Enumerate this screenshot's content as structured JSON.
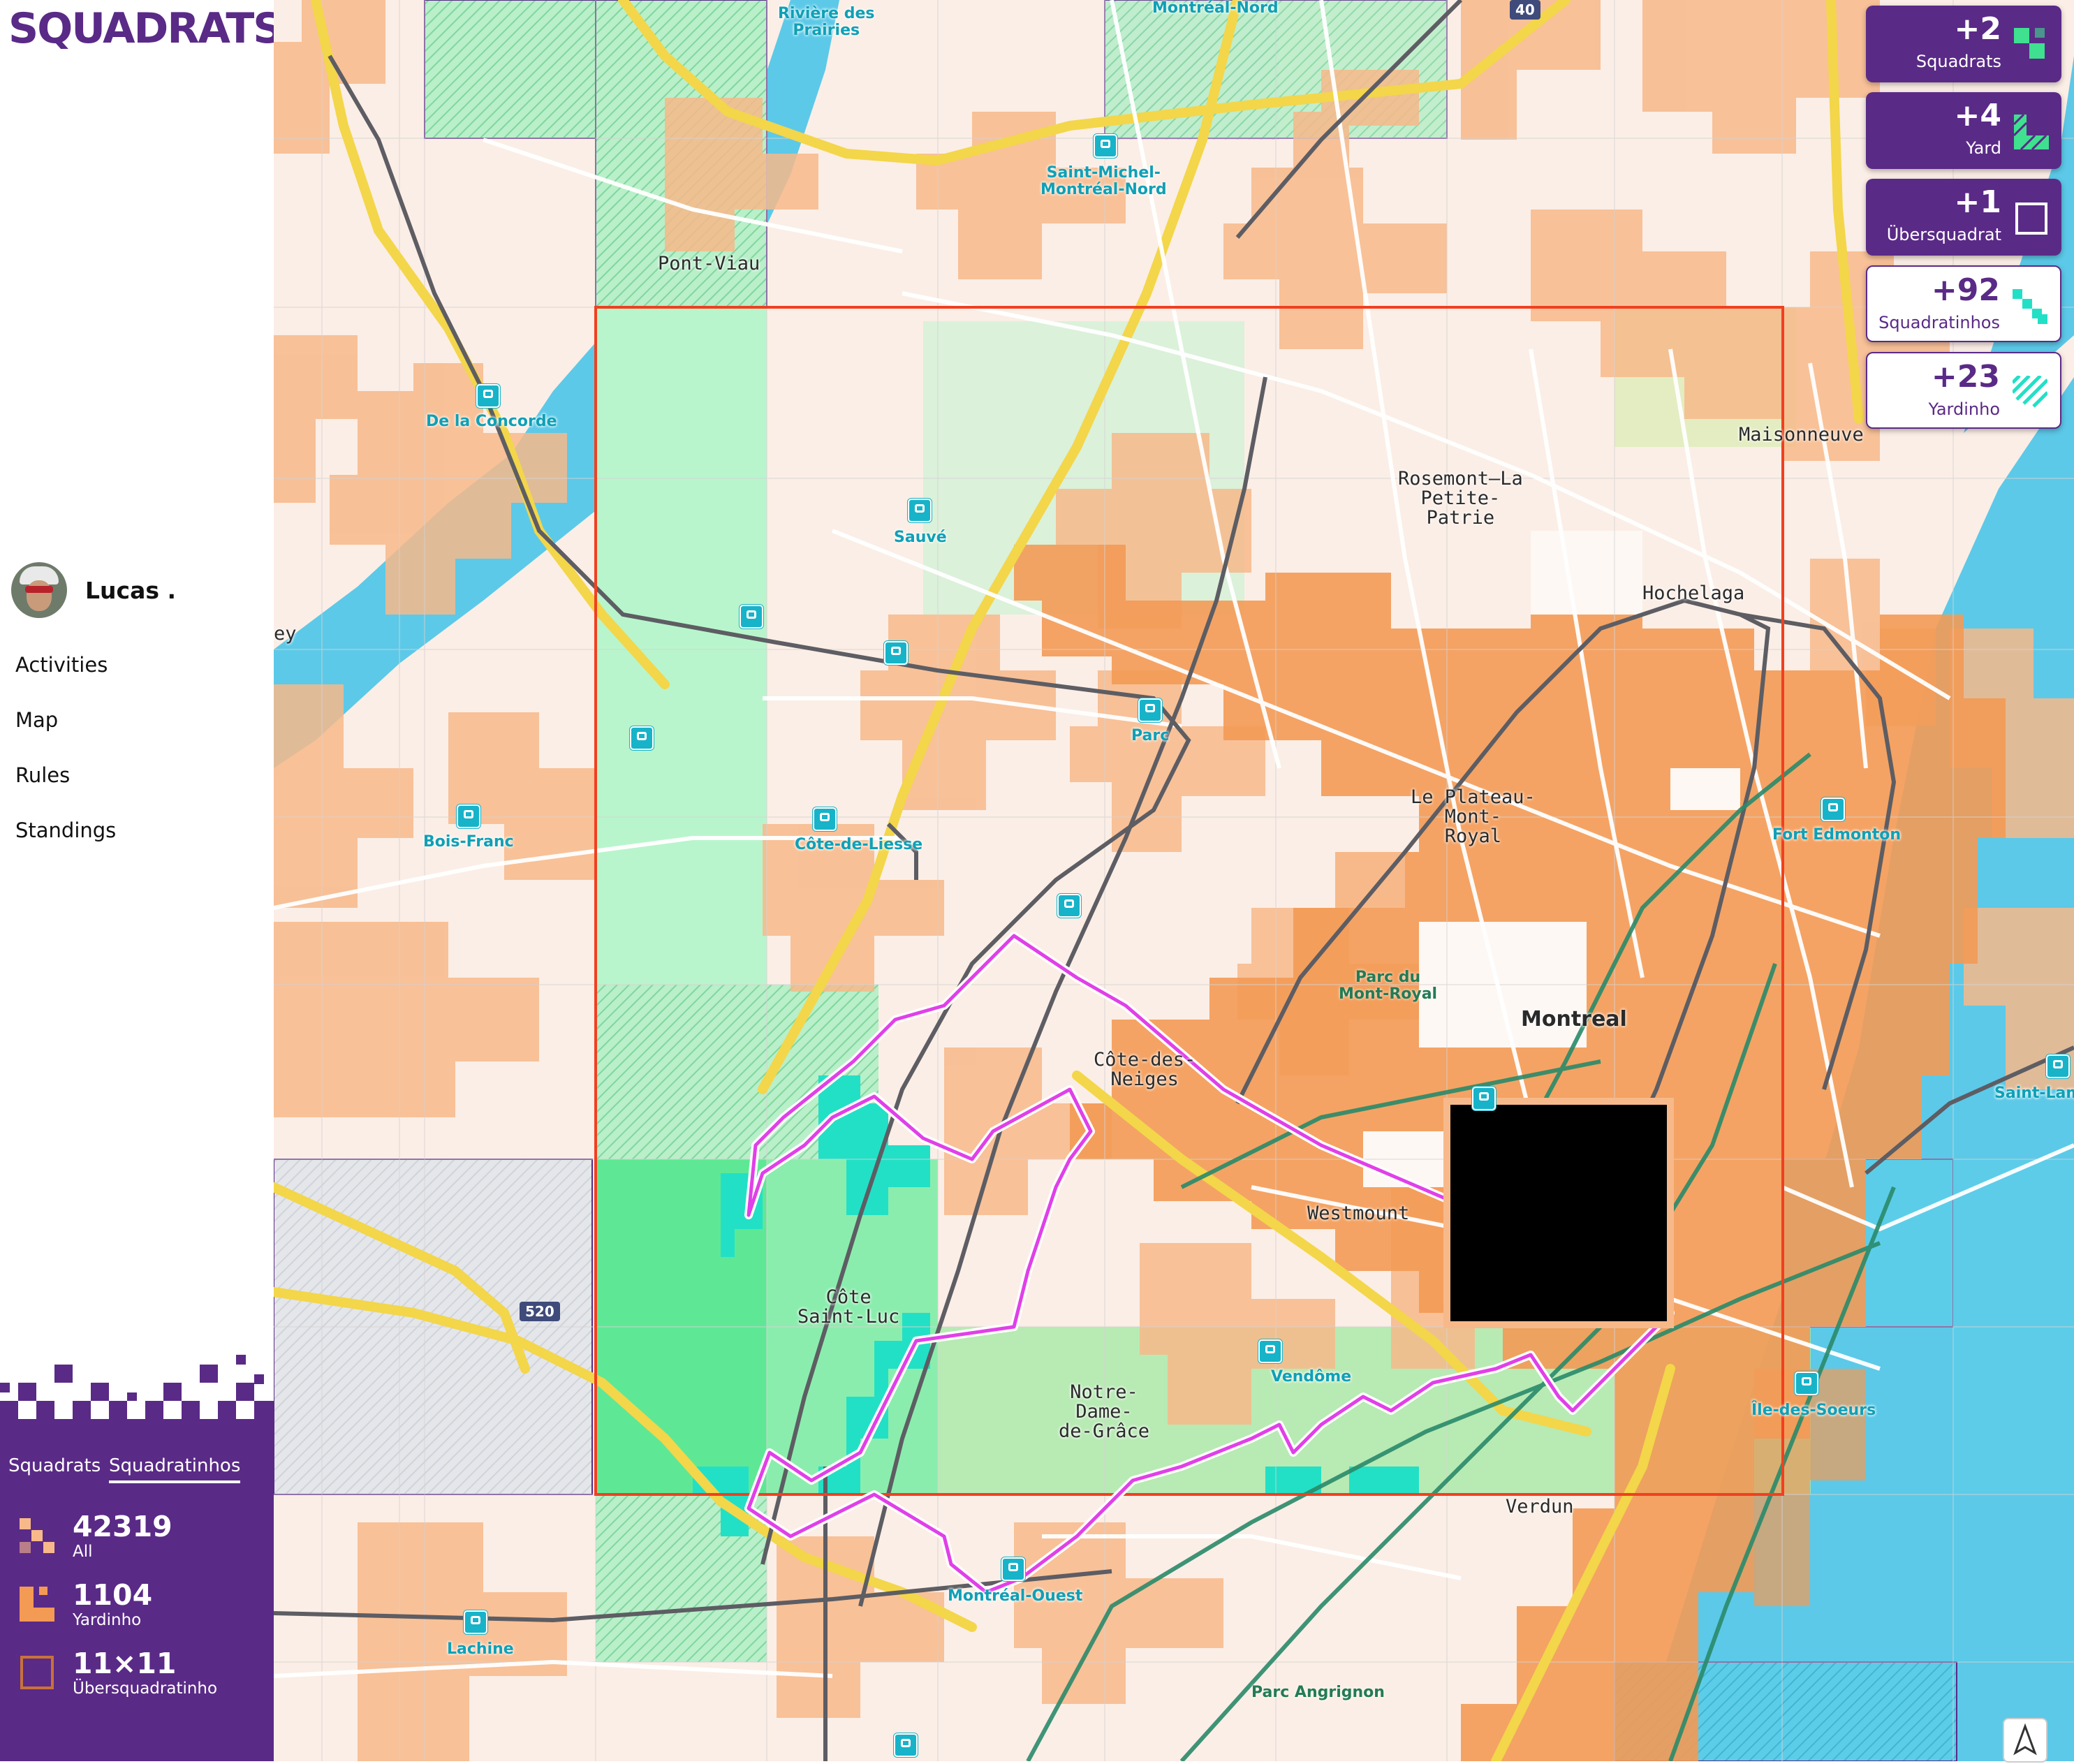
{
  "app": {
    "logo": "SQUADRATS"
  },
  "user": {
    "name": "Lucas ."
  },
  "nav": [
    {
      "label": "Activities"
    },
    {
      "label": "Map"
    },
    {
      "label": "Rules"
    },
    {
      "label": "Standings"
    }
  ],
  "stats": {
    "tabs": [
      {
        "label": "Squadrats"
      },
      {
        "label": "Squadratinhos"
      }
    ],
    "active_tab": "Squadratinhos",
    "rows": [
      {
        "value": "42319",
        "label": "All",
        "icon": "squadratinhos-all-icon"
      },
      {
        "value": "1104",
        "label": "Yardinho",
        "icon": "yardinho-icon"
      },
      {
        "value": "11×11",
        "label": "Übersquadratinho",
        "icon": "ubersquadratinho-icon"
      }
    ]
  },
  "cards": [
    {
      "value": "+2",
      "label": "Squadrats",
      "icon": "squadrats-icon",
      "style": "dark"
    },
    {
      "value": "+4",
      "label": "Yard",
      "icon": "yard-icon",
      "style": "dark"
    },
    {
      "value": "+1",
      "label": "Übersquadrat",
      "icon": "ubersquadrat-icon",
      "style": "dark"
    },
    {
      "value": "+92",
      "label": "Squadratinhos",
      "icon": "squadratinhos-icon",
      "style": "light"
    },
    {
      "value": "+23",
      "label": "Yardinho",
      "icon": "yardinho-icon",
      "style": "light"
    }
  ],
  "map": {
    "places": [
      {
        "name": "Pont-Viau"
      },
      {
        "name": "Maisonneuve"
      },
      {
        "name": "Rosemont—La\nPetite-\nPatrie"
      },
      {
        "name": "Hochelaga"
      },
      {
        "name": "Le Plateau-\nMont-\nRoyal"
      },
      {
        "name": "Montreal"
      },
      {
        "name": "Côte-des-\nNeiges"
      },
      {
        "name": "Westmount"
      },
      {
        "name": "Côte\nSaint-Luc"
      },
      {
        "name": "Notre-\nDame-\nde-Grâce"
      },
      {
        "name": "Verdun"
      },
      {
        "name": "ey"
      }
    ],
    "stations": [
      {
        "name": "Rivière des\nPrairies"
      },
      {
        "name": "Montréal-Nord"
      },
      {
        "name": "Saint-Michel-\nMontréal-Nord"
      },
      {
        "name": "De la Concorde"
      },
      {
        "name": "Sauvé"
      },
      {
        "name": "Parc"
      },
      {
        "name": "Côte-de-Liesse"
      },
      {
        "name": "Bois-Franc"
      },
      {
        "name": "Fort Edmonton"
      },
      {
        "name": "Saint-Lam"
      },
      {
        "name": "Vendôme"
      },
      {
        "name": "Île-des-Soeurs"
      },
      {
        "name": "Montréal-Ouest"
      },
      {
        "name": "Lachine"
      }
    ],
    "parks": [
      {
        "name": "Parc du\nMont-Royal"
      },
      {
        "name": "Parc Angrignon"
      }
    ],
    "shields": [
      {
        "label": "40"
      },
      {
        "label": "520"
      }
    ]
  },
  "colors": {
    "brand": "#5a2a87",
    "squadratinho": "#f7b98a",
    "yardinho": "#f39a55",
    "squadrat": "#7fe0a4",
    "new_tiles": "#22e0c6",
    "route": "#e040e8",
    "ubersquadratinho_frame": "#f04020",
    "water": "#5cc9e8"
  }
}
